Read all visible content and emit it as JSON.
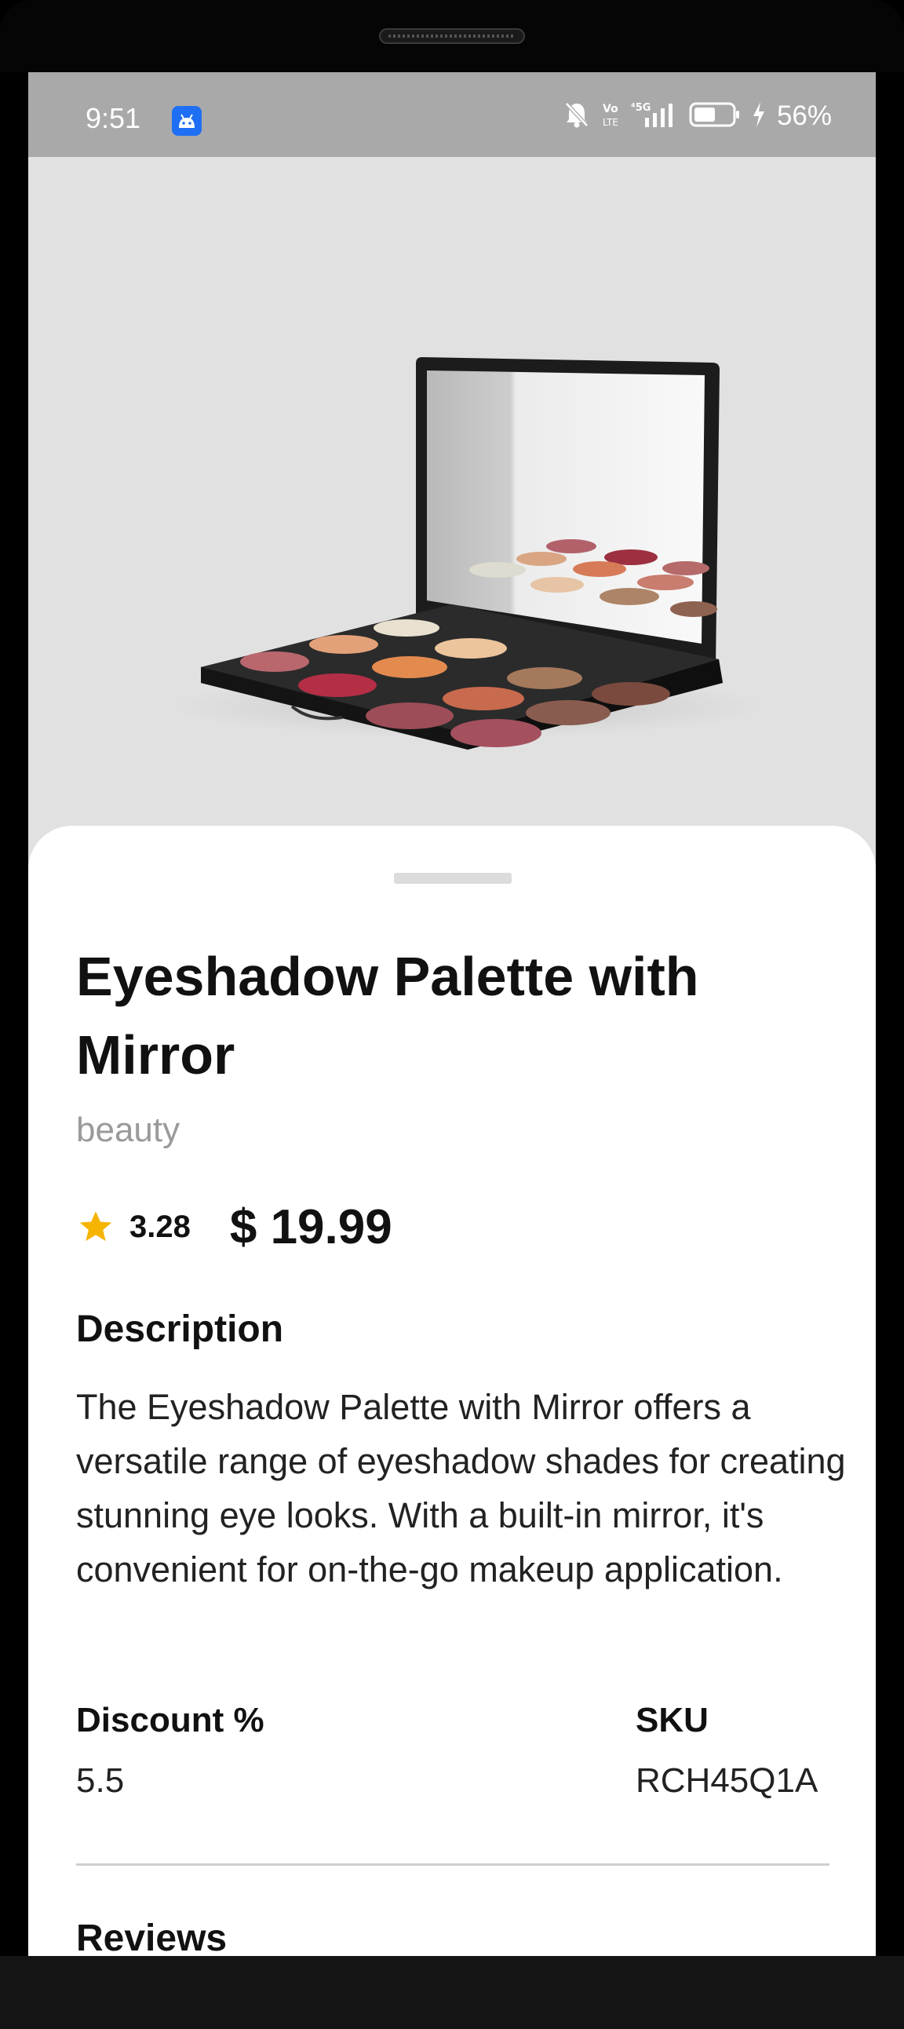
{
  "status_bar": {
    "time": "9:51",
    "app_icon": "android-icon",
    "icons": [
      "bell-off-icon",
      "volte-icon",
      "signal-5g-icon",
      "battery-icon",
      "charging-icon"
    ],
    "battery_percent": "56%"
  },
  "product": {
    "image_subject": "eyeshadow-palette-with-mirror",
    "title": "Eyeshadow Palette with Mirror",
    "category": "beauty",
    "rating": "3.28",
    "price": "$ 19.99",
    "description_heading": "Description",
    "description": "The Eyeshadow Palette with Mirror offers a versatile range of eyeshadow shades for creating stunning eye looks. With a built-in mirror, it's convenient for on-the-go makeup application.",
    "discount_label": "Discount %",
    "discount_value": "5.5",
    "sku_label": "SKU",
    "sku_value": "RCH45Q1A",
    "reviews_heading": "Reviews"
  },
  "colors": {
    "status_bar_bg": "#a9a9a9",
    "hero_bg": "#e1e1e1",
    "star": "#f5b400",
    "app_icon_blue": "#1e6ff3"
  }
}
